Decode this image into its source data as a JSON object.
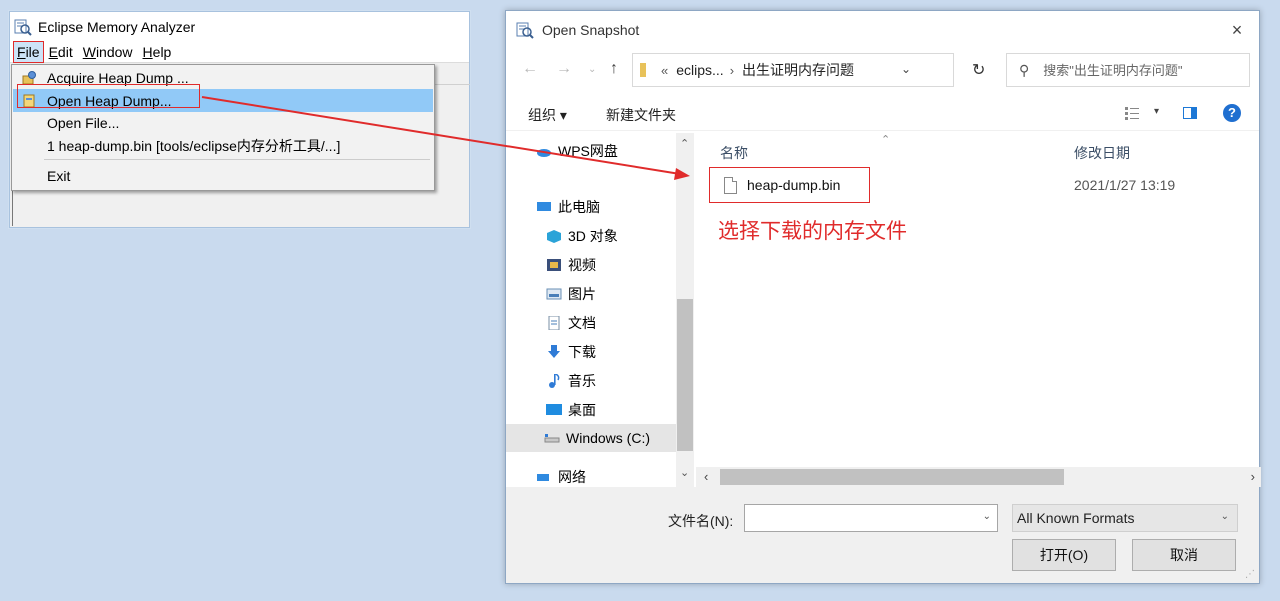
{
  "mat": {
    "title": "Eclipse Memory Analyzer",
    "menubar": [
      {
        "label": "File",
        "mnemonic_rest": "ile",
        "mnemonic": "F"
      },
      {
        "label": "Edit",
        "mnemonic_rest": "dit",
        "mnemonic": "E"
      },
      {
        "label": "Window",
        "mnemonic_rest": "indow",
        "mnemonic": "W"
      },
      {
        "label": "Help",
        "mnemonic_rest": "elp",
        "mnemonic": "H"
      }
    ],
    "file_menu": [
      {
        "label": "Acquire Heap Dump ...",
        "icon": "acquire-heap-dump-icon"
      },
      {
        "label": "Open Heap Dump...",
        "icon": "open-heap-dump-icon",
        "highlighted": true
      },
      {
        "label": "Open File...",
        "icon": ""
      },
      {
        "label": "1  heap-dump.bin  [tools/eclipse内存分析工具/...]",
        "icon": ""
      },
      {
        "label": "Exit",
        "icon": ""
      }
    ]
  },
  "dialog": {
    "title": "Open Snapshot",
    "close_icon": "×",
    "breadcrumb": {
      "prefix": "«",
      "parts": [
        "eclips...",
        "出生证明内存问题"
      ]
    },
    "search_placeholder": "搜索\"出生证明内存问题\"",
    "toolbar": {
      "organize": "组织 ▾",
      "new_folder": "新建文件夹"
    },
    "nav_items": [
      {
        "label": "WPS网盘",
        "icon": "cloud-icon"
      },
      {
        "label": "此电脑",
        "icon": "computer-icon"
      },
      {
        "label": "3D 对象",
        "icon": "3d-objects-icon"
      },
      {
        "label": "视频",
        "icon": "video-icon"
      },
      {
        "label": "图片",
        "icon": "picture-icon"
      },
      {
        "label": "文档",
        "icon": "document-icon"
      },
      {
        "label": "下载",
        "icon": "download-icon"
      },
      {
        "label": "音乐",
        "icon": "music-icon"
      },
      {
        "label": "桌面",
        "icon": "desktop-icon"
      },
      {
        "label": "Windows (C:)",
        "icon": "drive-icon"
      },
      {
        "label": "网络",
        "icon": "network-icon"
      }
    ],
    "columns": {
      "name": "名称",
      "modified": "修改日期"
    },
    "files": [
      {
        "name": "heap-dump.bin",
        "modified": "2021/1/27 13:19"
      }
    ],
    "annotation": "选择下载的内存文件",
    "filename_label": "文件名(N):",
    "filename_value": "",
    "format": "All Known Formats",
    "open_button": "打开(O)",
    "cancel_button": "取消"
  },
  "colors": {
    "highlight": "#e02b2b",
    "selection": "#91c9f7",
    "accent": "#1d78d6"
  }
}
